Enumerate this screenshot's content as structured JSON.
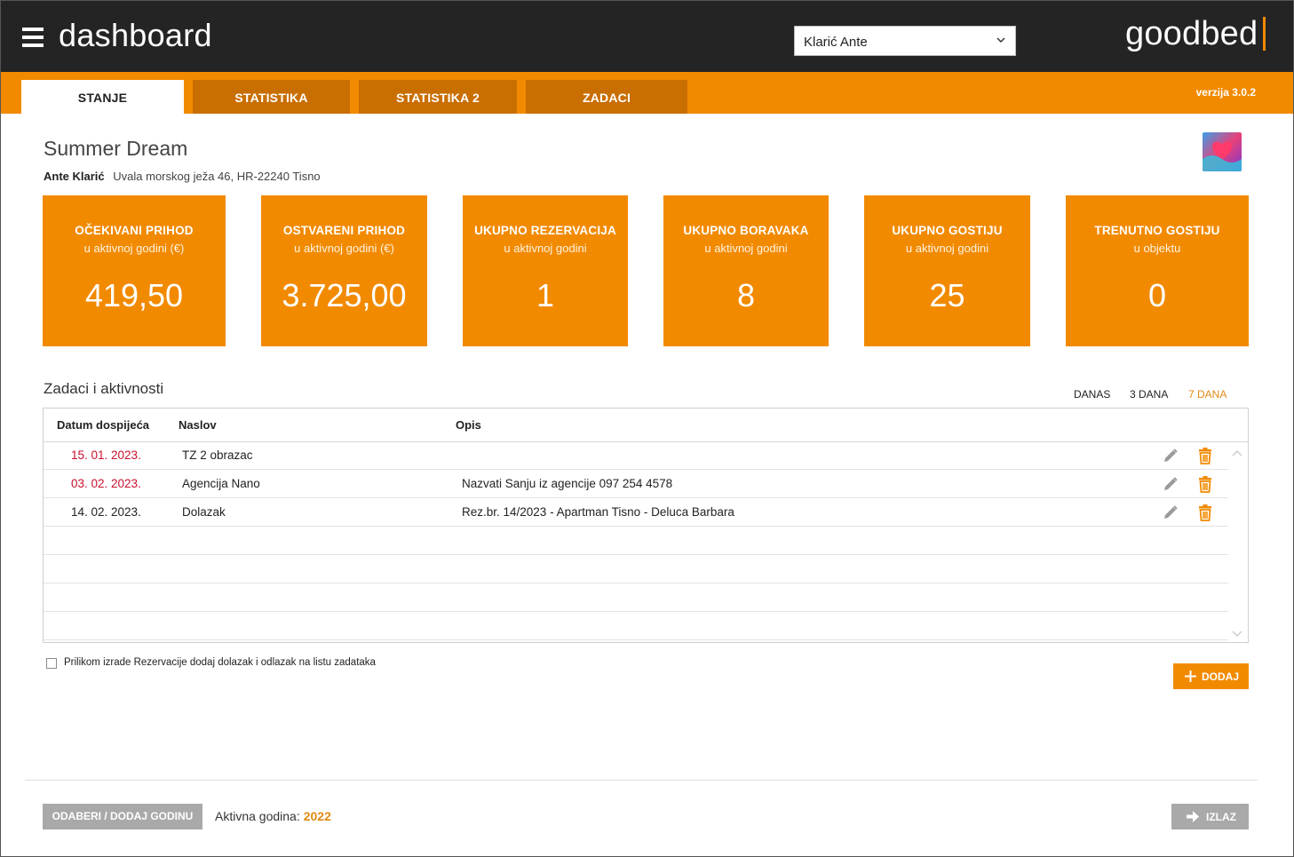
{
  "header": {
    "title": "dashboard",
    "user_selected": "Klarić Ante",
    "logo": "goodbed"
  },
  "tabs": [
    {
      "label": "STANJE",
      "active": true
    },
    {
      "label": "STATISTIKA",
      "active": false
    },
    {
      "label": "STATISTIKA 2",
      "active": false
    },
    {
      "label": "ZADACI",
      "active": false
    }
  ],
  "version": "verzija 3.0.2",
  "property": {
    "name": "Summer Dream",
    "owner": "Ante Klarić",
    "address": "Uvala morskog ježa 46, HR-22240 Tisno"
  },
  "cards": [
    {
      "title": "OČEKIVANI PRIHOD",
      "subtitle": "u aktivnoj godini (€)",
      "value": "419,50"
    },
    {
      "title": "OSTVARENI PRIHOD",
      "subtitle": "u aktivnoj godini (€)",
      "value": "3.725,00"
    },
    {
      "title": "UKUPNO REZERVACIJA",
      "subtitle": "u aktivnoj godini",
      "value": "1"
    },
    {
      "title": "UKUPNO BORAVAKA",
      "subtitle": "u aktivnoj godini",
      "value": "8"
    },
    {
      "title": "UKUPNO GOSTIJU",
      "subtitle": "u aktivnoj godini",
      "value": "25"
    },
    {
      "title": "TRENUTNO GOSTIJU",
      "subtitle": "u objektu",
      "value": "0"
    }
  ],
  "tasks": {
    "title": "Zadaci i aktivnosti",
    "ranges": [
      {
        "label": "DANAS",
        "active": false
      },
      {
        "label": "3 DANA",
        "active": false
      },
      {
        "label": "7 DANA",
        "active": true
      }
    ],
    "columns": [
      "Datum dospijeća",
      "Naslov",
      "Opis"
    ],
    "rows": [
      {
        "date": "15. 01. 2023.",
        "title": "TZ 2 obrazac",
        "desc": "",
        "overdue": true
      },
      {
        "date": "03. 02. 2023.",
        "title": "Agencija Nano",
        "desc": "Nazvati Sanju iz agencije 097 254 4578",
        "overdue": true
      },
      {
        "date": "14. 02. 2023.",
        "title": "Dolazak",
        "desc": "Rez.br. 14/2023 - Apartman Tisno - Deluca Barbara",
        "overdue": false
      }
    ]
  },
  "checkbox_label": "Prilikom izrade Rezervacije dodaj dolazak i odlazak na listu zadataka",
  "add_label": "DODAJ",
  "footer": {
    "year_button": "ODABERI / DODAJ GODINU",
    "active_year_label": "Aktivna godina:",
    "active_year": "2022",
    "exit_label": "IZLAZ"
  },
  "colors": {
    "accent": "#f28a00",
    "header_bg": "#242424",
    "overdue": "#c8102e"
  }
}
